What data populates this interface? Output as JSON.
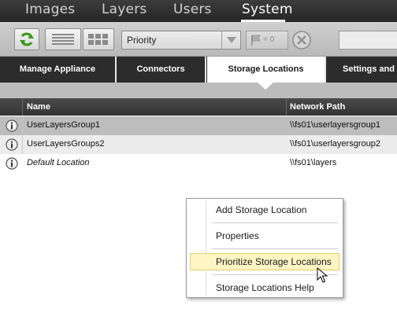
{
  "topnav": {
    "tabs": [
      "Images",
      "Layers",
      "Users",
      "System"
    ],
    "active": "System"
  },
  "toolbar": {
    "refresh_icon": "refresh-icon",
    "list_view_icon": "list-view-icon",
    "grid_view_icon": "grid-view-icon",
    "priority_select": "Priority",
    "flag_count": "= 0",
    "flag_icon": "flag-icon",
    "clear_icon": "clear-filter-icon",
    "accent": "#3b9a1d"
  },
  "subtabs": {
    "items": [
      "Manage Appliance",
      "Connectors",
      "Storage Locations",
      "Settings and"
    ],
    "active": "Storage Locations"
  },
  "table": {
    "columns": [
      "Name",
      "Network Path"
    ],
    "rows": [
      {
        "name": "UserLayersGroup1",
        "path": "\\\\fs01\\userlayersgroup1",
        "selected": true
      },
      {
        "name": "UserLayersGroups2",
        "path": "\\\\fs01\\userlayersgroup2",
        "selected": false
      },
      {
        "name": "Default Location",
        "path": "\\\\fs01\\layers",
        "selected": false
      }
    ],
    "info_icon": "info-icon"
  },
  "context_menu": {
    "items": [
      "Add Storage Location",
      "Properties",
      "Prioritize Storage Locations",
      "Storage Locations Help"
    ],
    "highlighted": "Prioritize Storage Locations"
  }
}
